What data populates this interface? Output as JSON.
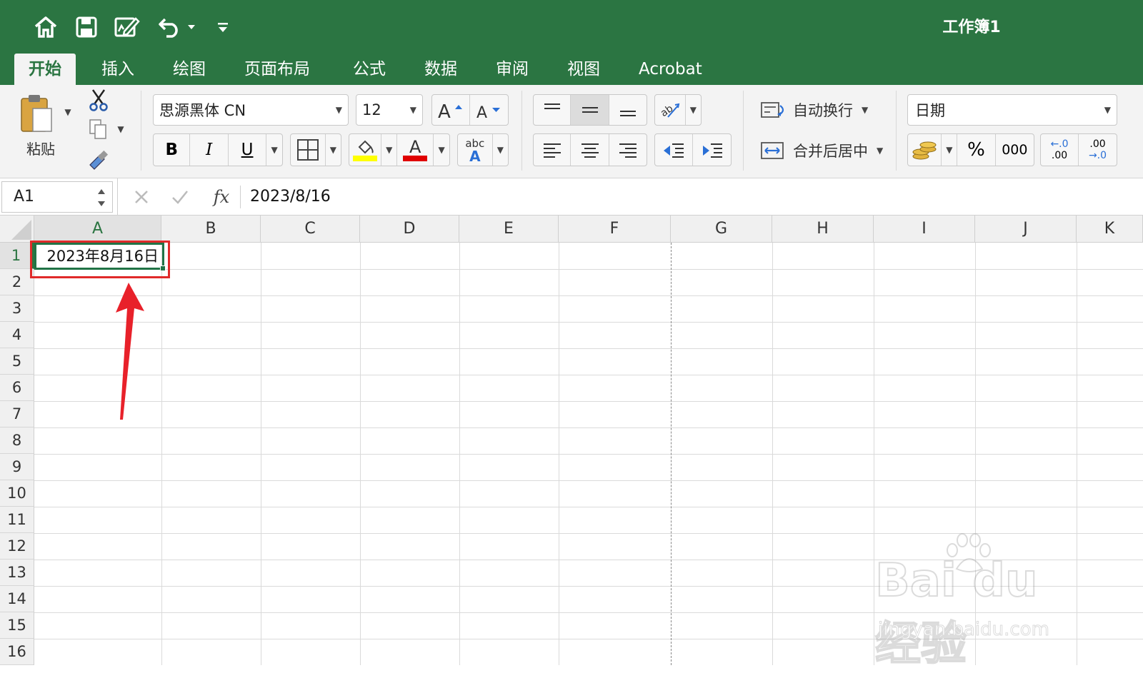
{
  "title_bar": {
    "document_title": "工作簿1"
  },
  "tabs": [
    {
      "label": "开始",
      "active": true
    },
    {
      "label": "插入"
    },
    {
      "label": "绘图"
    },
    {
      "label": "页面布局"
    },
    {
      "label": "公式"
    },
    {
      "label": "数据"
    },
    {
      "label": "审阅"
    },
    {
      "label": "视图"
    },
    {
      "label": "Acrobat"
    }
  ],
  "ribbon": {
    "paste_label": "粘贴",
    "font_name": "思源黑体 CN",
    "font_size": "12",
    "bold": "B",
    "italic": "I",
    "underline": "U",
    "font_color_letter": "A",
    "text_effect_top": "abc",
    "text_effect_bottom": "A",
    "wrap_text_label": "自动换行",
    "merge_center_label": "合并后居中",
    "number_format": "日期",
    "percent": "%",
    "comma": "000",
    "increase_decimal_top": "←.0",
    "increase_decimal_bottom": ".00",
    "decrease_decimal_top": ".00",
    "decrease_decimal_bottom": "→.0",
    "fill_color": "#ffff00",
    "font_color": "#e00000"
  },
  "formula_bar": {
    "name_box": "A1",
    "fx": "fx",
    "value": "2023/8/16"
  },
  "sheet": {
    "columns": [
      "A",
      "B",
      "C",
      "D",
      "E",
      "F",
      "G",
      "H",
      "I",
      "J",
      "K"
    ],
    "rows": [
      "1",
      "2",
      "3",
      "4",
      "5",
      "6",
      "7",
      "8",
      "9",
      "10",
      "11",
      "12",
      "13",
      "14",
      "15",
      "16"
    ],
    "cell_a1": "2023年8月16日"
  },
  "watermark": {
    "main": "Bai du 经验",
    "sub": "jingyan.baidu.com"
  },
  "colors": {
    "accent": "#2b7542",
    "annotation": "#e02a2a"
  }
}
